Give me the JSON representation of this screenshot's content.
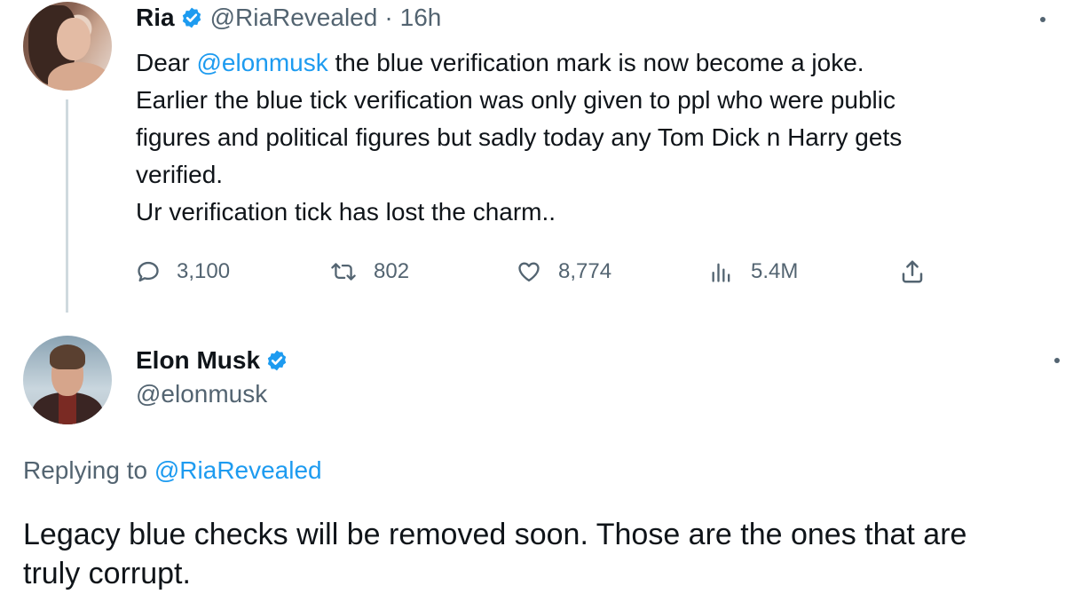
{
  "colors": {
    "text": "#0f1419",
    "secondary": "#536471",
    "link": "#1d9bf0",
    "verified": "#1d9bf0",
    "thread_line": "#cfd9de"
  },
  "tweet": {
    "author_name": "Ria",
    "author_handle": "@RiaRevealed",
    "separator": "·",
    "time": "16h",
    "body": {
      "line1_prefix": "Dear ",
      "line1_mention": "@elonmusk",
      "line1_suffix": " the blue verification mark is now become a joke.",
      "line2": "Earlier the blue tick verification was only given to ppl who were public",
      "line3": "figures and political figures but sadly today any Tom Dick n Harry gets",
      "line4": "verified.",
      "line5": "Ur verification tick has lost the charm.."
    },
    "actions": {
      "replies": "3,100",
      "retweets": "802",
      "likes": "8,774",
      "views": "5.4M"
    },
    "icons": {
      "reply": "reply-icon",
      "retweet": "retweet-icon",
      "like": "heart-icon",
      "views": "views-icon",
      "share": "share-icon",
      "more": "more-icon",
      "verified": "verified-badge-icon"
    }
  },
  "reply_tweet": {
    "author_name": "Elon Musk",
    "author_handle": "@elonmusk",
    "replying_prefix": "Replying to ",
    "replying_to": "@RiaRevealed",
    "text_line1": "Legacy blue checks will be removed soon. Those are the ones that are",
    "text_line2": "truly corrupt."
  }
}
